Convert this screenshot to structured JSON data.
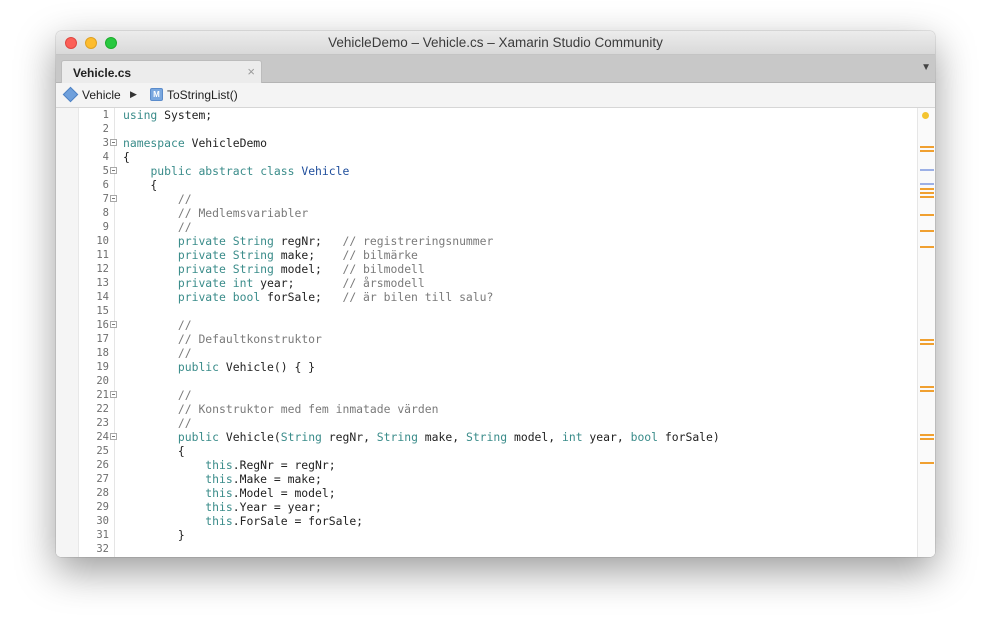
{
  "window": {
    "title": "VehicleDemo – Vehicle.cs – Xamarin Studio Community"
  },
  "tabs": [
    {
      "label": "Vehicle.cs",
      "close_glyph": "×",
      "active": true
    }
  ],
  "tab_menu_glyph": "▼",
  "breadcrumb": {
    "class_name": "Vehicle",
    "separator": "▶",
    "method_icon_letter": "M",
    "method_name": "ToStringList()"
  },
  "editor": {
    "line_numbers": [
      "1",
      "2",
      "3",
      "4",
      "5",
      "6",
      "7",
      "8",
      "9",
      "10",
      "11",
      "12",
      "13",
      "14",
      "15",
      "16",
      "17",
      "18",
      "19",
      "20",
      "21",
      "22",
      "23",
      "24",
      "25",
      "26",
      "27",
      "28",
      "29",
      "30",
      "31",
      "32"
    ],
    "lines": [
      "using System;",
      "",
      "namespace VehicleDemo",
      "{",
      "    public abstract class Vehicle",
      "    {",
      "        //",
      "        // Medlemsvariabler",
      "        //",
      "        private String regNr;   // registreringsnummer",
      "        private String make;    // bilmärke",
      "        private String model;   // bilmodell",
      "        private int year;       // årsmodell",
      "        private bool forSale;   // är bilen till salu?",
      "",
      "        //",
      "        // Defaultkonstruktor",
      "        //",
      "        public Vehicle() { }",
      "",
      "        //",
      "        // Konstruktor med fem inmatade värden",
      "        //",
      "        public Vehicle(String regNr, String make, String model, int year, bool forSale)",
      "        {",
      "            this.RegNr = regNr;",
      "            this.Make = make;",
      "            this.Model = model;",
      "            this.Year = year;",
      "            this.ForSale = forSale;",
      "        }",
      ""
    ],
    "fold_lines": [
      3,
      5,
      7,
      16,
      21,
      24
    ]
  },
  "colors": {
    "keyword": "#3a8c8a",
    "type": "#1f4e9c",
    "comment": "#7a7a7a",
    "text": "#222222",
    "minimap_warning": "#f0a030"
  },
  "icons": {
    "class_icon": "class-diamond-icon",
    "method_icon": "method-square-icon",
    "fold_icon": "fold-minus-icon"
  }
}
